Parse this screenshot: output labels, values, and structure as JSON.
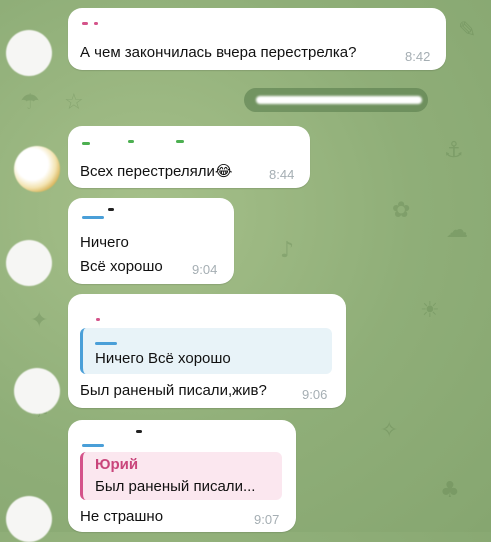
{
  "messages": [
    {
      "text": "А чем закончилась вчера перестрелка?",
      "time": "8:42",
      "name_color": "#d4538a"
    },
    {
      "text": "Всех перестреляли",
      "emoji": "😂",
      "time": "8:44",
      "name_color": "#4caf50"
    },
    {
      "lines": [
        "Ничего",
        "Всё хорошо"
      ],
      "time": "9:04",
      "name_color": "#4a9fd8"
    },
    {
      "quote": "Ничего  Всё хорошо",
      "text": "Был раненый писали,жив?",
      "time": "9:06",
      "name_color": "#d4538a"
    },
    {
      "quote_name": "Юрий",
      "quote": "Был раненый писали...",
      "text": "Не страшно",
      "time": "9:07",
      "name_color": "#4a9fd8"
    }
  ],
  "colors": {
    "quote_blue": "#4a9fd8",
    "quote_pink": "#d4538a",
    "time": "#a5aeb3"
  }
}
